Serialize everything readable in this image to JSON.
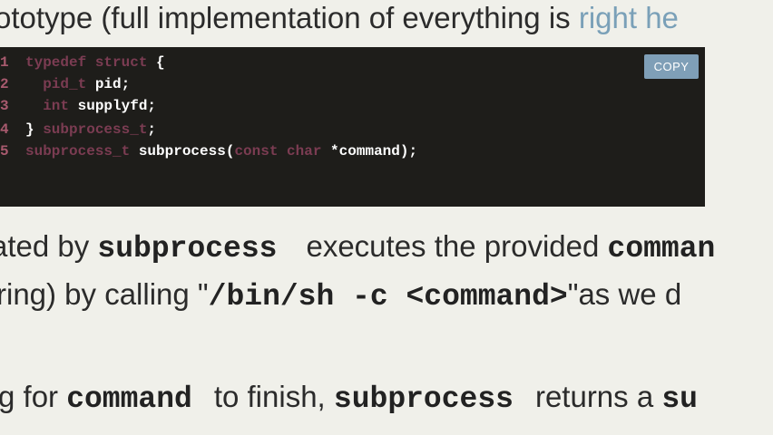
{
  "heading": {
    "text_before_link": "ototype (full implementation of everything is ",
    "link_text": "right he"
  },
  "code": {
    "copy_label": "COPY",
    "lines": [
      {
        "num": "1",
        "parts": [
          {
            "t": "typedef struct",
            "kw": true
          },
          {
            "t": " {",
            "kw": false
          }
        ]
      },
      {
        "num": "2",
        "parts": [
          {
            "t": "  ",
            "kw": false
          },
          {
            "t": "pid_t",
            "kw": true
          },
          {
            "t": " pid;",
            "kw": false
          }
        ]
      },
      {
        "num": "3",
        "parts": [
          {
            "t": "  ",
            "kw": false
          },
          {
            "t": "int",
            "kw": true
          },
          {
            "t": " supplyfd;",
            "kw": false
          }
        ]
      },
      {
        "num": "4",
        "parts": [
          {
            "t": "} ",
            "kw": false
          },
          {
            "t": "subprocess_t",
            "kw": true
          },
          {
            "t": ";",
            "kw": false
          }
        ]
      },
      {
        "num": "5",
        "parts": [
          {
            "t": "subprocess_t",
            "kw": true
          },
          {
            "t": " subprocess(",
            "kw": false
          },
          {
            "t": "const char",
            "kw": true
          },
          {
            "t": " *command);",
            "kw": false
          }
        ]
      }
    ]
  },
  "paragraph1": {
    "text1": "ated by ",
    "code1": "subprocess",
    "text2": "executes the provided ",
    "code2": "comman"
  },
  "paragraph2": {
    "text1": "ring) by calling \"",
    "code1": "/bin/sh -c <command>",
    "text2": "\"as we d"
  },
  "paragraph3": {
    "text1": "g for ",
    "code1": "command",
    "text2": "to finish, ",
    "code2": "subprocess",
    "text3": "returns a ",
    "code3": "su"
  }
}
